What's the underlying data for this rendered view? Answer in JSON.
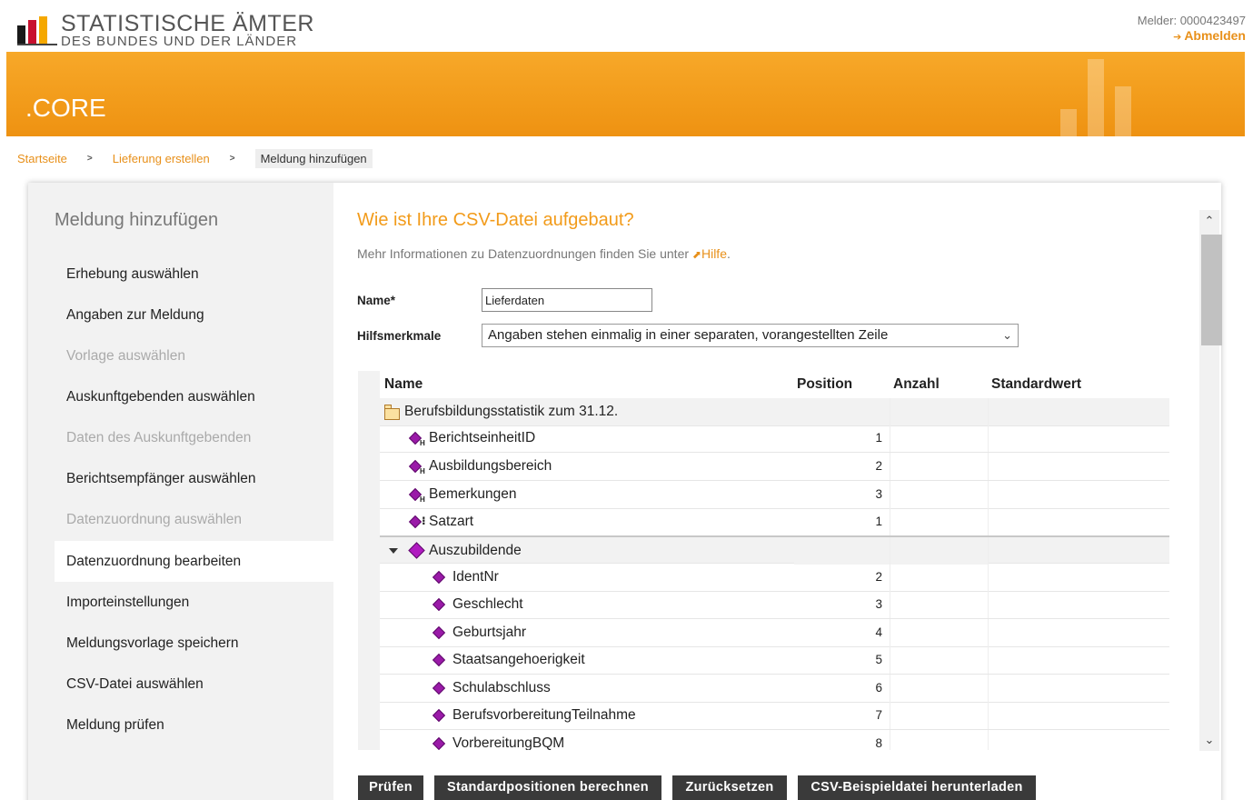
{
  "header": {
    "logo_title": "STATISTISCHE ÄMTER",
    "logo_subtitle": "DES BUNDES UND DER LÄNDER",
    "melder": "Melder: 0000423497",
    "logout": "Abmelden",
    "app_name": ".CORE",
    "brand_color": "#f29b1a"
  },
  "breadcrumb": {
    "items": [
      "Startseite",
      "Lieferung erstellen"
    ],
    "current": "Meldung hinzufügen"
  },
  "sidebar": {
    "title": "Meldung hinzufügen",
    "items": [
      {
        "label": "Erhebung auswählen",
        "state": "enabled"
      },
      {
        "label": "Angaben zur Meldung",
        "state": "enabled"
      },
      {
        "label": "Vorlage auswählen",
        "state": "disabled"
      },
      {
        "label": "Auskunftgebenden auswählen",
        "state": "enabled"
      },
      {
        "label": "Daten des Auskunftgebenden",
        "state": "disabled"
      },
      {
        "label": "Berichtsempfänger auswählen",
        "state": "enabled"
      },
      {
        "label": "Datenzuordnung auswählen",
        "state": "disabled"
      },
      {
        "label": "Datenzuordnung bearbeiten",
        "state": "active"
      },
      {
        "label": "Importeinstellungen",
        "state": "enabled"
      },
      {
        "label": "Meldungsvorlage speichern",
        "state": "enabled"
      },
      {
        "label": "CSV-Datei auswählen",
        "state": "enabled"
      },
      {
        "label": "Meldung prüfen",
        "state": "enabled"
      }
    ]
  },
  "main": {
    "heading": "Wie ist Ihre CSV-Datei aufgebaut?",
    "info_text": "Mehr Informationen zu Datenzuordnungen finden Sie unter",
    "info_link": "Hilfe",
    "info_end": ".",
    "name_label": "Name",
    "name_required": "*",
    "name_value": "Lieferdaten",
    "hilfs_label": "Hilfsmerkmale",
    "hilfs_value": "Angaben stehen einmalig in einer separaten, vorangestellten Zeile"
  },
  "table": {
    "headers": {
      "name": "Name",
      "position": "Position",
      "anzahl": "Anzahl",
      "standardwert": "Standardwert"
    },
    "rows": [
      {
        "name": "Berufsbildungsstatistik zum 31.12.",
        "position": "",
        "icon": "folder-icon",
        "indent": 0,
        "group": true
      },
      {
        "name": "BerichtseinheitID",
        "position": "1",
        "icon": "merkmal-h-icon",
        "indent": 1
      },
      {
        "name": "Ausbildungsbereich",
        "position": "2",
        "icon": "merkmal-h-icon",
        "indent": 1
      },
      {
        "name": "Bemerkungen",
        "position": "3",
        "icon": "merkmal-h-icon",
        "indent": 1
      },
      {
        "name": "Satzart",
        "position": "1",
        "icon": "satzart-icon",
        "indent": 1
      },
      {
        "name": "Auszubildende",
        "position": "",
        "icon": "group-icon",
        "indent": 1,
        "group": true,
        "expanded": true
      },
      {
        "name": "IdentNr",
        "position": "2",
        "icon": "merkmal-icon",
        "indent": 2
      },
      {
        "name": "Geschlecht",
        "position": "3",
        "icon": "merkmal-icon",
        "indent": 2
      },
      {
        "name": "Geburtsjahr",
        "position": "4",
        "icon": "merkmal-icon",
        "indent": 2
      },
      {
        "name": "Staatsangehoerigkeit",
        "position": "5",
        "icon": "merkmal-icon",
        "indent": 2
      },
      {
        "name": "Schulabschluss",
        "position": "6",
        "icon": "merkmal-icon",
        "indent": 2
      },
      {
        "name": "BerufsvorbereitungTeilnahme",
        "position": "7",
        "icon": "merkmal-icon",
        "indent": 2
      },
      {
        "name": "VorbereitungBQM",
        "position": "8",
        "icon": "merkmal-icon",
        "indent": 2
      }
    ]
  },
  "buttons": {
    "pruefen": "Prüfen",
    "standardpositionen": "Standardpositionen berechnen",
    "zuruecksetzen": "Zurücksetzen",
    "csv_download": "CSV-Beispieldatei herunterladen"
  }
}
